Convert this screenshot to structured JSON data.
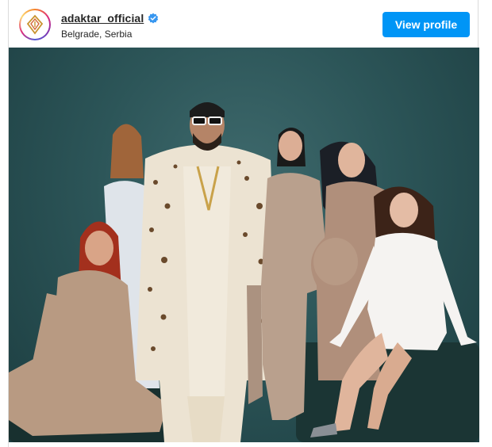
{
  "post": {
    "username": "adaktar_official",
    "location": "Belgrade, Serbia",
    "view_profile_label": "View profile",
    "verified": true,
    "icons": {
      "avatar": "brand-logo-icon",
      "verified": "verified-badge-icon"
    },
    "colors": {
      "accent": "#0095f6",
      "photo_background": "#2c5558"
    }
  }
}
